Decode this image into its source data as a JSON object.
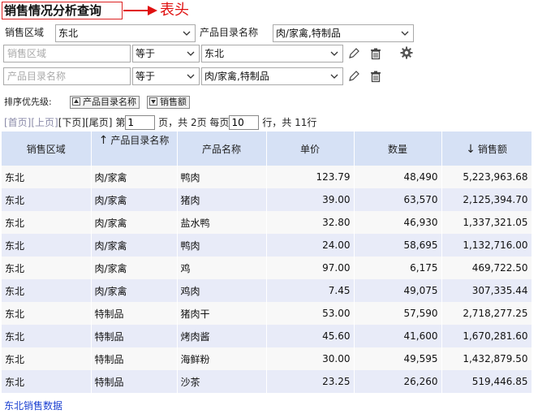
{
  "header": {
    "title": "销售情况分析查询",
    "annotation": "表头"
  },
  "filter_row": {
    "region_label": "销售区域",
    "region_value": "东北",
    "catalog_label": "产品目录名称",
    "catalog_value": "肉/家禽,特制品"
  },
  "conditions": [
    {
      "field_placeholder": "销售区域",
      "operator": "等于",
      "value": "东北"
    },
    {
      "field_placeholder": "产品目录名称",
      "operator": "等于",
      "value": "肉/家禽,特制品"
    }
  ],
  "sort": {
    "label": "排序优先级:",
    "items": [
      {
        "label": "产品目录名称",
        "dir": "up"
      },
      {
        "label": "销售额",
        "dir": "down"
      }
    ]
  },
  "pager": {
    "first": "[首页]",
    "prev": "[上页]",
    "next": "[下页]",
    "last": "[尾页]",
    "page_prefix": "第",
    "current_page": "1",
    "page_suffix": "页，共 2页 每页",
    "page_size": "10",
    "total_text": "行，共 11行"
  },
  "table": {
    "columns": [
      {
        "label": "销售区域",
        "sort": ""
      },
      {
        "label": "产品目录名称",
        "sort": "↑"
      },
      {
        "label": "产品名称",
        "sort": ""
      },
      {
        "label": "单价",
        "sort": ""
      },
      {
        "label": "数量",
        "sort": ""
      },
      {
        "label": "销售额",
        "sort": "↓"
      }
    ],
    "rows": [
      [
        "东北",
        "肉/家禽",
        "鸭肉",
        "123.79",
        "48,490",
        "5,223,963.68"
      ],
      [
        "东北",
        "肉/家禽",
        "猪肉",
        "39.00",
        "63,570",
        "2,125,394.70"
      ],
      [
        "东北",
        "肉/家禽",
        "盐水鸭",
        "32.80",
        "46,930",
        "1,337,321.05"
      ],
      [
        "东北",
        "肉/家禽",
        "鸭肉",
        "24.00",
        "58,695",
        "1,132,716.00"
      ],
      [
        "东北",
        "肉/家禽",
        "鸡",
        "97.00",
        "6,175",
        "469,722.50"
      ],
      [
        "东北",
        "肉/家禽",
        "鸡肉",
        "7.45",
        "49,075",
        "307,335.44"
      ],
      [
        "东北",
        "特制品",
        "猪肉干",
        "53.00",
        "57,590",
        "2,718,277.25"
      ],
      [
        "东北",
        "特制品",
        "烤肉酱",
        "45.60",
        "41,600",
        "1,670,281.60"
      ],
      [
        "东北",
        "特制品",
        "海鲜粉",
        "30.00",
        "49,595",
        "1,432,879.50"
      ],
      [
        "东北",
        "特制品",
        "沙茶",
        "23.25",
        "26,260",
        "519,446.85"
      ]
    ]
  },
  "footer": {
    "link": "东北销售数据"
  },
  "colors": {
    "header_bg": "#d6e1f5",
    "row_even": "#e8ebf8",
    "row_odd": "#f8f8f8",
    "annotation": "#e01010",
    "link": "#1a3fd1"
  }
}
